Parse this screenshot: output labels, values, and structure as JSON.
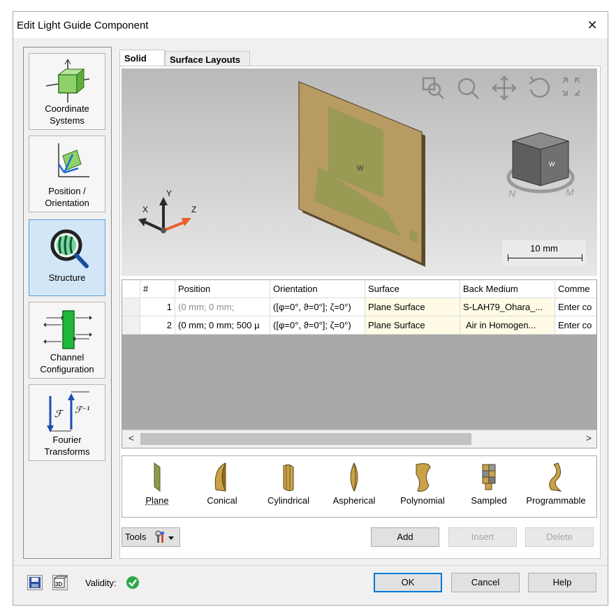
{
  "window": {
    "title": "Edit Light Guide Component",
    "close_glyph": "✕"
  },
  "nav": {
    "items": [
      {
        "label_lines": [
          "Coordinate",
          "Systems"
        ],
        "icon": "coordinate-systems-icon"
      },
      {
        "label_lines": [
          "Position /",
          "Orientation"
        ],
        "icon": "position-orientation-icon"
      },
      {
        "label_lines": [
          "Structure"
        ],
        "icon": "structure-icon",
        "active": true
      },
      {
        "label_lines": [
          "Channel",
          "Configuration"
        ],
        "icon": "channel-configuration-icon"
      },
      {
        "label_lines": [
          "Fourier",
          "Transforms"
        ],
        "icon": "fourier-transforms-icon"
      }
    ]
  },
  "tabs": [
    {
      "label": "Solid",
      "active": true
    },
    {
      "label": "Surface Layouts",
      "active": false
    }
  ],
  "viewport": {
    "toolbar_icons": [
      "zoom-window-icon",
      "zoom-icon",
      "pan-icon",
      "rotate-icon",
      "fit-icon"
    ],
    "axes": {
      "x": "X",
      "y": "Y",
      "z": "Z"
    },
    "scale_label": "10 mm",
    "cube_face_label": "W"
  },
  "table": {
    "columns": [
      "",
      "#",
      "Position",
      "Orientation",
      "Surface",
      "Back Medium",
      "Comme"
    ],
    "rows": [
      {
        "num": "1",
        "position": "(0 mm; 0 mm;",
        "orientation": "([φ=0°, ϑ=0°]; ζ=0°)",
        "surface": "Plane Surface",
        "back_medium": "S-LAH79_Ohara_...",
        "comment": "Enter co"
      },
      {
        "num": "2",
        "position": "(0 mm; 0 mm; 500 µ",
        "orientation": "([φ=0°, ϑ=0°]; ζ=0°)",
        "surface": "Plane Surface",
        "back_medium": "Air in Homogen...",
        "comment": "Enter co"
      }
    ],
    "scroll_left": "<",
    "scroll_right": ">"
  },
  "palette": {
    "items": [
      {
        "label": "Plane",
        "selected": true
      },
      {
        "label": "Conical"
      },
      {
        "label": "Cylindrical"
      },
      {
        "label": "Aspherical"
      },
      {
        "label": "Polynomial"
      },
      {
        "label": "Sampled"
      },
      {
        "label": "Programmable"
      }
    ]
  },
  "actions": {
    "tools_label": "Tools",
    "add_label": "Add",
    "insert_label": "Insert",
    "delete_label": "Delete"
  },
  "footer": {
    "validity_label": "Validity:",
    "ok_label": "OK",
    "cancel_label": "Cancel",
    "help_label": "Help"
  },
  "colors": {
    "accent": "#0078d7",
    "nav_active_bg": "#d3e6f8",
    "plate_fill": "#b89a63",
    "valid_green": "#2ea84a"
  }
}
